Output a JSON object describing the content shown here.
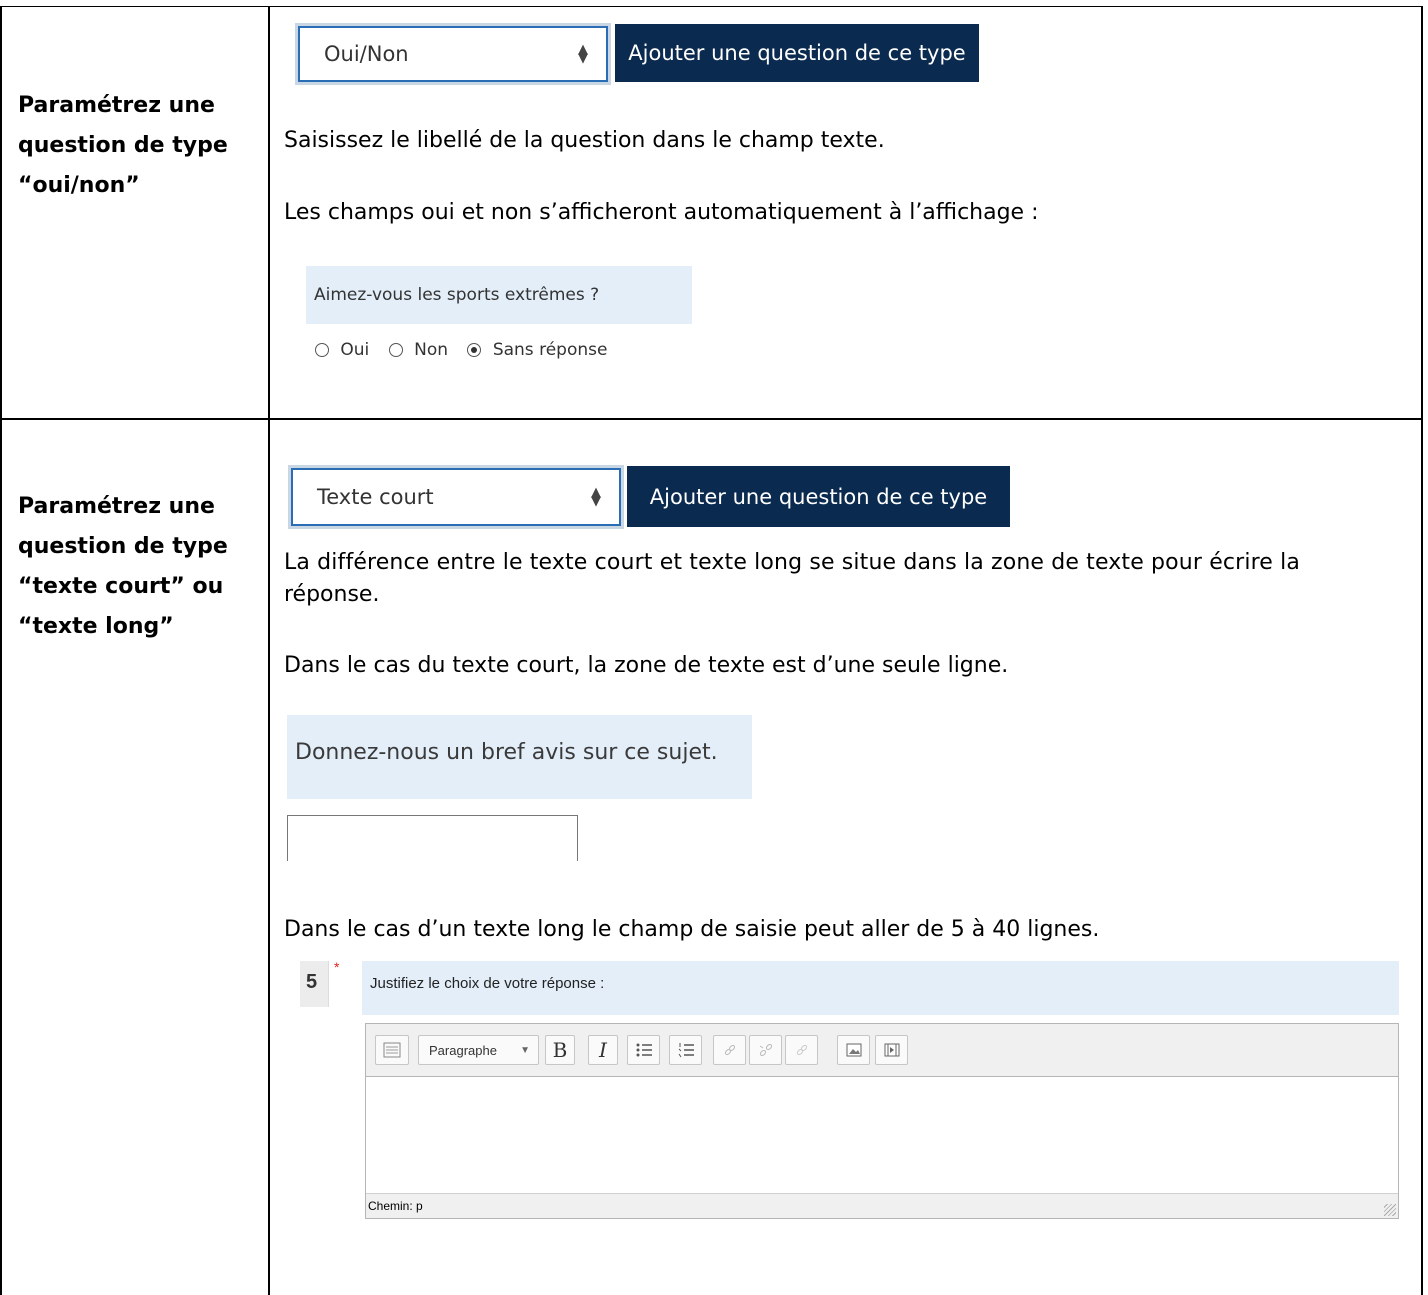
{
  "row1": {
    "label": [
      "Paramétrez une",
      "question de type",
      "“oui/non”"
    ],
    "select_value": "Oui/Non",
    "add_button": "Ajouter une question de ce type",
    "para1": "Saisissez le libellé de la question dans le champ texte.",
    "para2": "Les champs oui et non s’afficheront automatiquement à l’affichage :",
    "preview_question": "Aimez-vous les sports extrêmes ?",
    "options": [
      "Oui",
      "Non",
      "Sans réponse"
    ],
    "selected_option": "Sans réponse"
  },
  "row2": {
    "label": [
      "Paramétrez une",
      "question de type",
      "“texte court” ou",
      "“texte long”"
    ],
    "select_value": "Texte court",
    "add_button": "Ajouter une question de ce type",
    "para1_line1": "La différence entre le texte court et texte long se situe dans la zone de texte pour écrire la",
    "para1_line2": "réponse.",
    "para2": "Dans le cas du texte court, la zone de texte est d’une seule ligne.",
    "preview_question": "Donnez-nous un bref avis sur ce sujet.",
    "para3": "Dans le cas d’un texte long le champ de saisie peut aller de 5 à 40 lignes.",
    "long_question_number": "5",
    "required_mark": "*",
    "long_question": "Justifiez le choix de votre réponse :",
    "format_select": "Paragraphe",
    "bold": "B",
    "italic": "I",
    "status_path": "Chemin: p"
  }
}
